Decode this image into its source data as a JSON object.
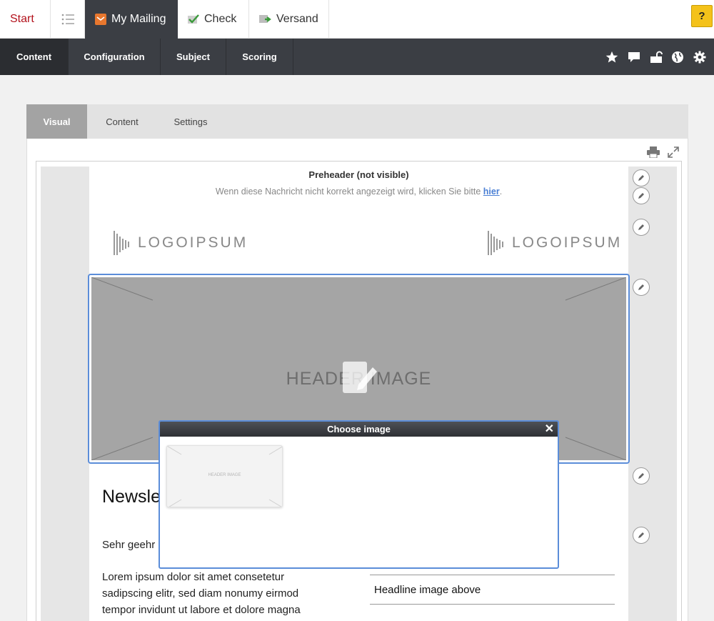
{
  "top_tabs": {
    "start": "Start",
    "my_mailing": "My Mailing",
    "check": "Check",
    "versand": "Versand",
    "help": "?"
  },
  "subnav": {
    "content": "Content",
    "configuration": "Configuration",
    "subject": "Subject",
    "scoring": "Scoring"
  },
  "inner_tabs": {
    "visual": "Visual",
    "content": "Content",
    "settings": "Settings"
  },
  "email": {
    "preheader_title": "Preheader (not visible)",
    "preheader_text": "Wenn diese Nachricht nicht korrekt angezeigt wird, klicken Sie bitte ",
    "preheader_link": "hier",
    "preheader_end": ".",
    "logo_left": "LOGOIPSUM",
    "logo_right": "LOGOIPSUM",
    "header_image_label": "HEADER IMAGE",
    "headline": "Newsle",
    "salutation": "Sehr geehr",
    "body_text": "Lorem ipsum dolor sit amet consetetur sadipscing elitr, sed diam nonumy eirmod tempor invidunt ut labore et dolore magna",
    "side_headline": "Headline image above"
  },
  "dialog": {
    "title": "Choose image",
    "close": "✕",
    "thumbnail_label": "HEADER IMAGE"
  },
  "colors": {
    "accent": "#5b8dd9",
    "dark_nav": "#3b3e44",
    "start_red": "#b3121c",
    "help_yellow": "#f4c21a"
  }
}
